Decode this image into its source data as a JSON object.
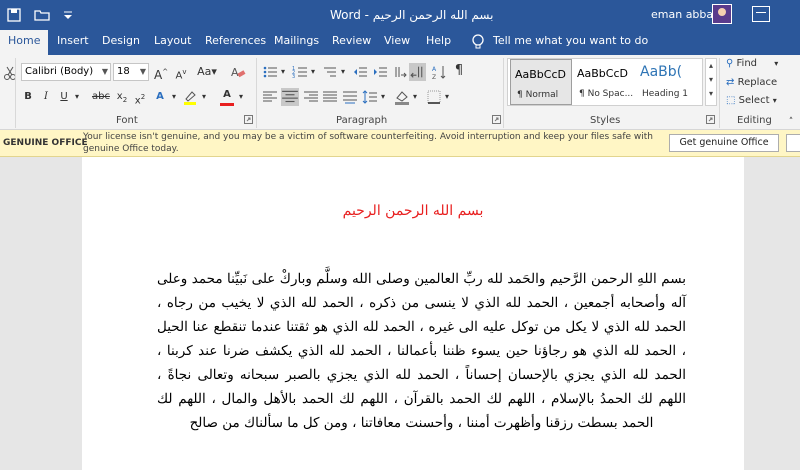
{
  "window": {
    "title": "بسم الله الرحمن الرحيم  -  Word",
    "user_name": "eman abbas"
  },
  "tabs": [
    {
      "label": "Home"
    },
    {
      "label": "Insert"
    },
    {
      "label": "Design"
    },
    {
      "label": "Layout"
    },
    {
      "label": "References"
    },
    {
      "label": "Mailings"
    },
    {
      "label": "Review"
    },
    {
      "label": "View"
    },
    {
      "label": "Help"
    }
  ],
  "tell_me": "Tell me what you want to do",
  "ribbon": {
    "font_name": "Calibri (Body)",
    "font_size": "18",
    "groups": {
      "font": "Font",
      "paragraph": "Paragraph",
      "styles": "Styles",
      "editing": "Editing"
    },
    "styles": [
      {
        "sample": "AaBbCcD",
        "name": "¶ Normal"
      },
      {
        "sample": "AaBbCcD",
        "name": "¶ No Spac..."
      },
      {
        "sample": "AaBb(",
        "name": "Heading 1"
      }
    ],
    "editing": {
      "find": "Find",
      "replace": "Replace",
      "select": "Select"
    }
  },
  "banner": {
    "label": "GENUINE OFFICE",
    "message": "Your license isn't genuine, and you may be a victim of software counterfeiting. Avoid interruption and keep your files safe with genuine Office today.",
    "button": "Get genuine Office"
  },
  "document": {
    "title": "بسم الله الرحمن الرحيم",
    "body": "بسم اللهِ الرحمن الرَّحيم والحَمد لله ربِّ العالمين وصلى الله وسلَّم وباركْ على نَبيِّنا محمد وعلى آله وأصحابه أجمعين ، الحمد لله الذي لا ينسى من ذكره ، الحمد لله الذي لا يخيب من رجاه ، الحمد لله الذي لا يكل من توكل عليه الى غيره ، الحمد لله الذي هو ثقتنا عندما تنقطع عنا الحيل ، الحمد لله الذي هو رجاؤنا حين يسوء ظننا بأعمالنا ، الحمد لله الذي يكشف ضرنا عند كربنا ، الحمد لله الذي يجزي بالإحسان إحساناً ، الحمد لله الذي يجزي بالصبر سبحانه وتعالى نجاةً ، اللهم لك الحمدُ بالإسلام ، اللهم لك الحمد بالقرآن ، اللهم لك الحمد بالأهل والمال ، اللهم لك الحمد بسطت رزقنا وأظهرت أمننا ، وأحسنت معافاتنا ، ومن كل ما سألناك من صالح"
  },
  "colors": {
    "accent": "#2b579a",
    "title_red": "#e81f1f",
    "banner_bg": "#fff6c5"
  }
}
